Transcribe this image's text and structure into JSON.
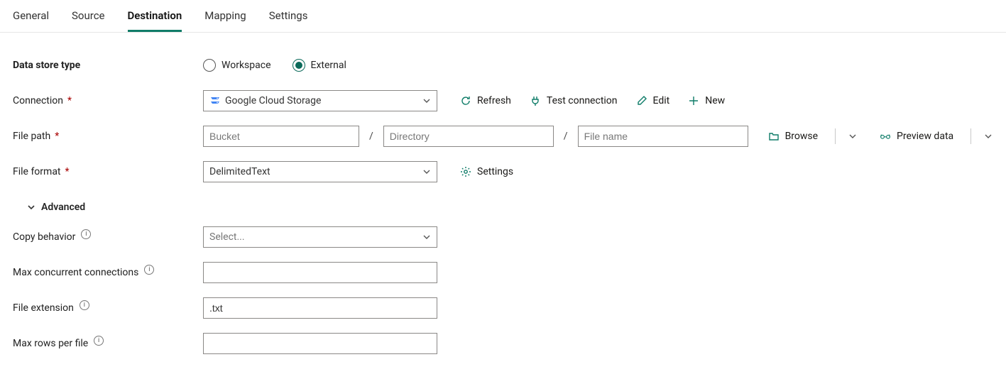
{
  "tabs": {
    "general": "General",
    "source": "Source",
    "destination": "Destination",
    "mapping": "Mapping",
    "settings": "Settings",
    "active": "destination"
  },
  "labels": {
    "data_store_type": "Data store type",
    "connection": "Connection",
    "file_path": "File path",
    "file_format": "File format",
    "advanced": "Advanced",
    "copy_behavior": "Copy behavior",
    "max_concurrent": "Max concurrent connections",
    "file_extension": "File extension",
    "max_rows": "Max rows per file"
  },
  "data_store_type": {
    "workspace": "Workspace",
    "external": "External",
    "selected": "external"
  },
  "connection": {
    "value": "Google Cloud Storage",
    "actions": {
      "refresh": "Refresh",
      "test": "Test connection",
      "edit": "Edit",
      "new": "New"
    }
  },
  "file_path": {
    "bucket_placeholder": "Bucket",
    "bucket_value": "",
    "directory_placeholder": "Directory",
    "directory_value": "",
    "file_placeholder": "File name",
    "file_value": "",
    "browse": "Browse",
    "preview": "Preview data"
  },
  "file_format": {
    "value": "DelimitedText",
    "settings": "Settings"
  },
  "advanced": {
    "copy_behavior_placeholder": "Select...",
    "copy_behavior_value": "",
    "max_concurrent_value": "",
    "file_extension_value": ".txt",
    "max_rows_value": ""
  }
}
